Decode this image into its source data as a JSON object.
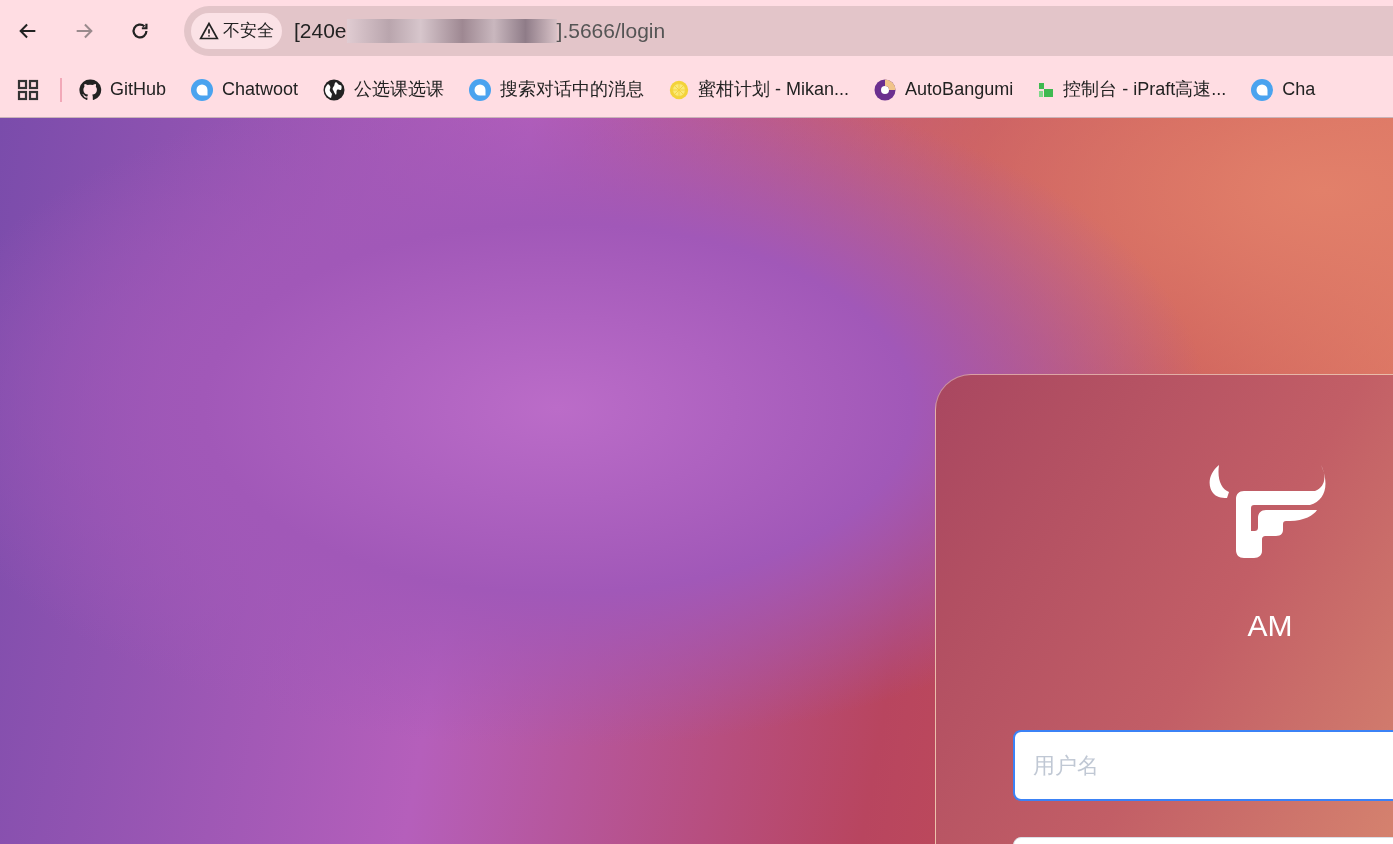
{
  "toolbar": {
    "back": {
      "disabled": false
    },
    "forward": {
      "disabled": true
    },
    "security_chip": "不安全",
    "url_start": "[240e",
    "url_end": "].5666/login"
  },
  "bookmarks": [
    {
      "kind": "github",
      "label": "GitHub"
    },
    {
      "kind": "chat",
      "label": "Chatwoot"
    },
    {
      "kind": "globe",
      "label": "公选课选课"
    },
    {
      "kind": "chat",
      "label": "搜索对话中的消息"
    },
    {
      "kind": "lemon",
      "label": "蜜柑计划 - Mikan..."
    },
    {
      "kind": "ring",
      "label": "AutoBangumi"
    },
    {
      "kind": "tiles",
      "label": "控制台 - iPraft高速..."
    },
    {
      "kind": "chat",
      "label": "Cha"
    }
  ],
  "login": {
    "title": "AM",
    "fields": [
      {
        "placeholder": "用户名",
        "focused": true
      },
      {
        "focused": false
      }
    ]
  }
}
